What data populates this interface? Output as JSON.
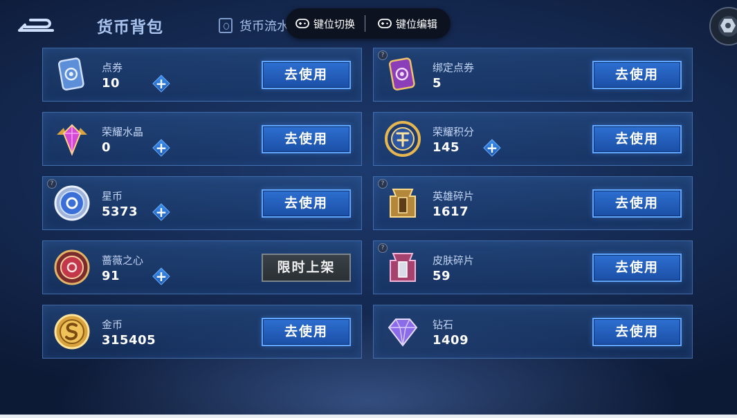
{
  "header": {
    "title": "货币背包",
    "tab_flow": "货币流水",
    "key_switch": "键位切换",
    "key_edit": "键位编辑"
  },
  "use_label": "去使用",
  "limited_label": "限时上架",
  "cards": [
    {
      "name": "点券",
      "value": "10"
    },
    {
      "name": "绑定点券",
      "value": "5"
    },
    {
      "name": "荣耀水晶",
      "value": "0"
    },
    {
      "name": "荣耀积分",
      "value": "145"
    },
    {
      "name": "星币",
      "value": "5373"
    },
    {
      "name": "英雄碎片",
      "value": "1617"
    },
    {
      "name": "蔷薇之心",
      "value": "91"
    },
    {
      "name": "皮肤碎片",
      "value": "59"
    },
    {
      "name": "金币",
      "value": "315405"
    },
    {
      "name": "钻石",
      "value": "1409"
    }
  ],
  "icons": {
    "back": "back-arrow-icon",
    "flow": "flow-icon",
    "settings": "settings-gear-icon",
    "gamepad": "gamepad-icon"
  },
  "colors": {
    "accent_button": "#2d6fd0",
    "plus": "#3a8ff0",
    "limited_button": "#3a4146"
  }
}
